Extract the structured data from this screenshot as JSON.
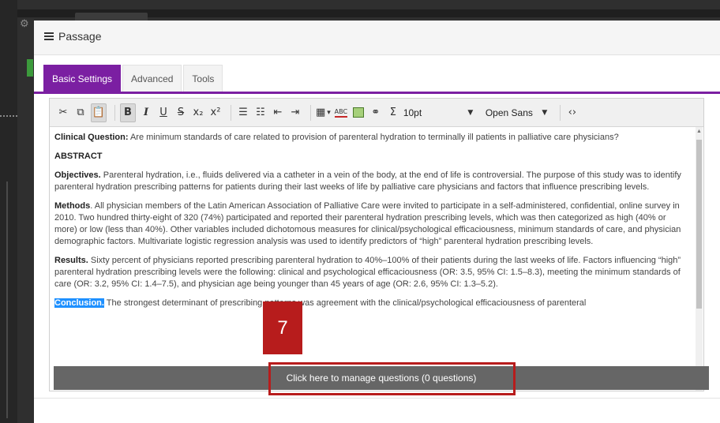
{
  "modal": {
    "title": "Passage"
  },
  "tabs": [
    {
      "label": "Basic Settings",
      "active": true
    },
    {
      "label": "Advanced",
      "active": false
    },
    {
      "label": "Tools",
      "active": false
    }
  ],
  "toolbar": {
    "font_size": "10pt",
    "font_family": "Open Sans",
    "sigma": "Σ",
    "icons": [
      "cut-icon",
      "copy-icon",
      "paste-icon",
      "bold-icon",
      "italic-icon",
      "underline-icon",
      "strikethrough-icon",
      "subscript-icon",
      "superscript-icon",
      "bullet-list-icon",
      "numbered-list-icon",
      "outdent-icon",
      "indent-icon",
      "table-icon",
      "spellcheck-icon",
      "image-icon",
      "link-icon",
      "formula-icon",
      "source-code-icon"
    ]
  },
  "content": {
    "clinical_label": "Clinical Question:",
    "clinical_text": " Are minimum standards of care related to provision of parenteral hydration to terminally ill patients in palliative care physicians?",
    "abstract_heading": "ABSTRACT",
    "objectives_label": "Objectives.",
    "objectives_text": " Parenteral hydration, i.e., fluids delivered via a catheter in a vein of the body, at the end of life is controversial. The purpose of this study was to identify parenteral hydration prescribing patterns for patients during their last weeks of life by palliative care physicians and factors that influence prescribing levels.",
    "methods_label": "Methods",
    "methods_text": ". All physician members of the Latin American Association of Palliative Care were invited to participate in a self-administered, confidential, online survey in 2010. Two hundred thirty-eight of 320 (74%) participated and reported their parenteral hydration prescribing levels, which was then categorized as high (40% or more) or low (less than 40%). Other variables included dichotomous measures for clinical/psychological efficaciousness, minimum standards of care, and physician demographic factors. Multivariate logistic regression analysis was used to identify predictors of “high” parenteral hydration prescribing levels.",
    "results_label": "Results.",
    "results_text": " Sixty percent of physicians reported prescribing parenteral hydration to 40%–100% of their patients during the last weeks of life. Factors influencing “high” parenteral hydration prescribing levels were the following: clinical and psychological efficaciousness (OR: 3.5, 95% CI: 1.5–8.3), meeting the minimum standards of care (OR: 3.2, 95% CI: 1.4–7.5), and physician age being younger than 45 years of age (OR: 2.6, 95% CI: 1.3–5.2).",
    "conclusion_label": "Conclusion.",
    "conclusion_text": " The strongest determinant of prescribing patterns was agreement with the clinical/psychological efficaciousness of parenteral"
  },
  "manage_button": "Click here to manage questions (0 questions)",
  "step_badge": "7",
  "colors": {
    "accent": "#7b1fa2",
    "highlight": "#b71c1c",
    "selection": "#1e90ff"
  }
}
